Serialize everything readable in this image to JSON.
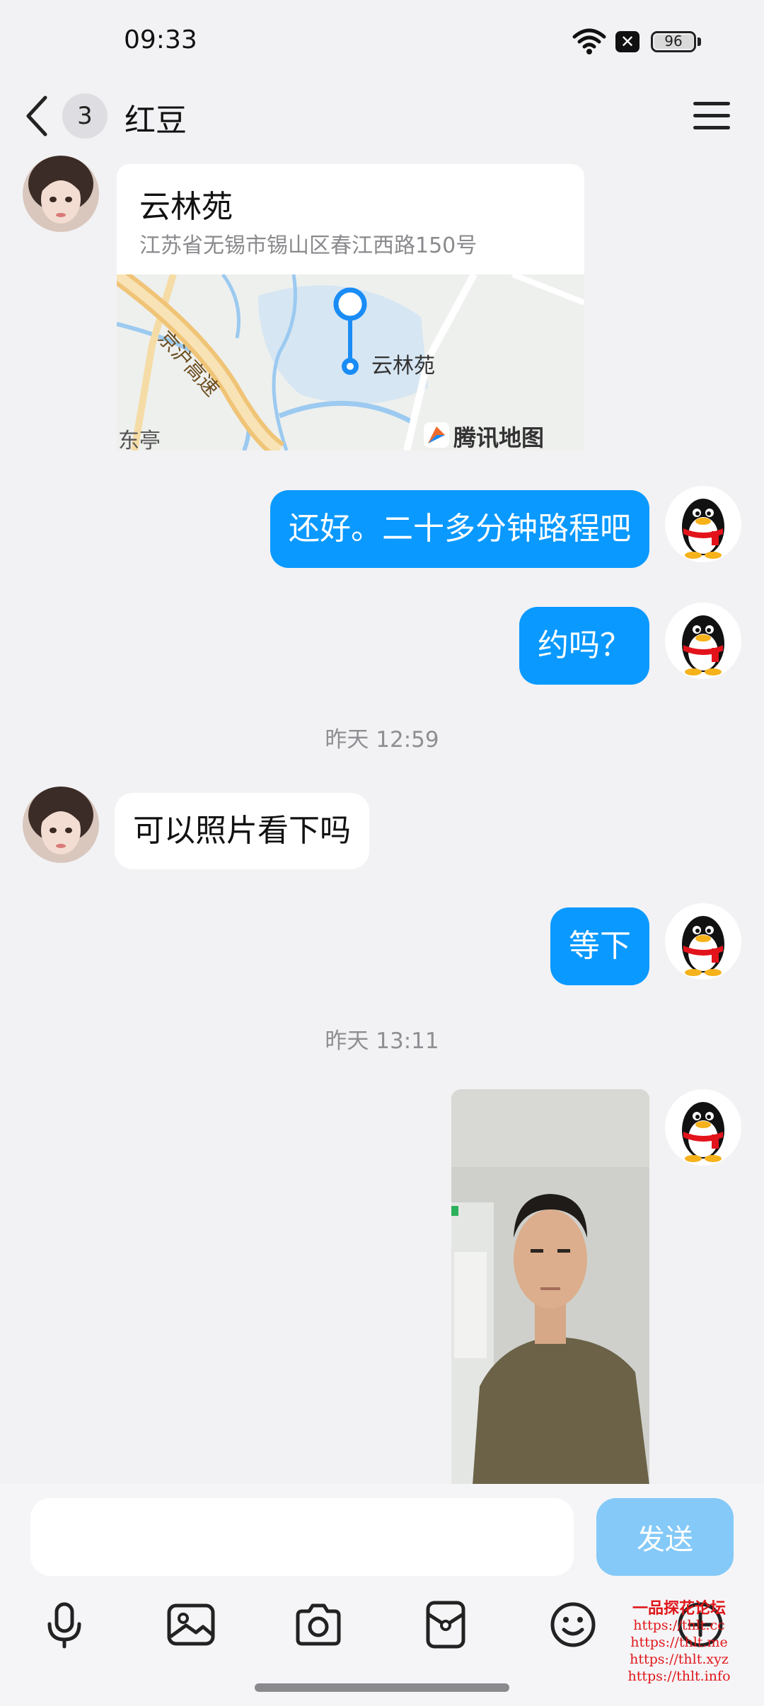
{
  "status_bar": {
    "time": "09:33",
    "battery": "96"
  },
  "header": {
    "unread_count": "3",
    "contact_name": "红豆"
  },
  "messages": {
    "location": {
      "name": "云林苑",
      "address": "江苏省无锡市锡山区春江西路150号",
      "map_pin_label": "云林苑",
      "map_road_label": "京沪高速",
      "map_area_label": "东亭",
      "map_brand": "腾讯地图"
    },
    "m1": "还好。二十多分钟路程吧",
    "m2": "约吗？",
    "time1": "昨天 12:59",
    "m3": "可以照片看下吗",
    "m4": "等下",
    "time2": "昨天 13:11"
  },
  "input": {
    "placeholder": "",
    "send_label": "发送"
  },
  "watermark": {
    "title": "一品探花论坛",
    "lines": [
      "https://thlt.cc",
      "https://thlt.me",
      "https://thlt.xyz",
      "https://thlt.info"
    ]
  },
  "colors": {
    "bubble_out": "#0a99ff",
    "send_button": "#84c9f8",
    "background": "#f2f2f4"
  },
  "icons": [
    "back-icon",
    "menu-icon",
    "mic-icon",
    "image-icon",
    "camera-icon",
    "red-packet-icon",
    "emoji-icon",
    "plus-icon"
  ]
}
